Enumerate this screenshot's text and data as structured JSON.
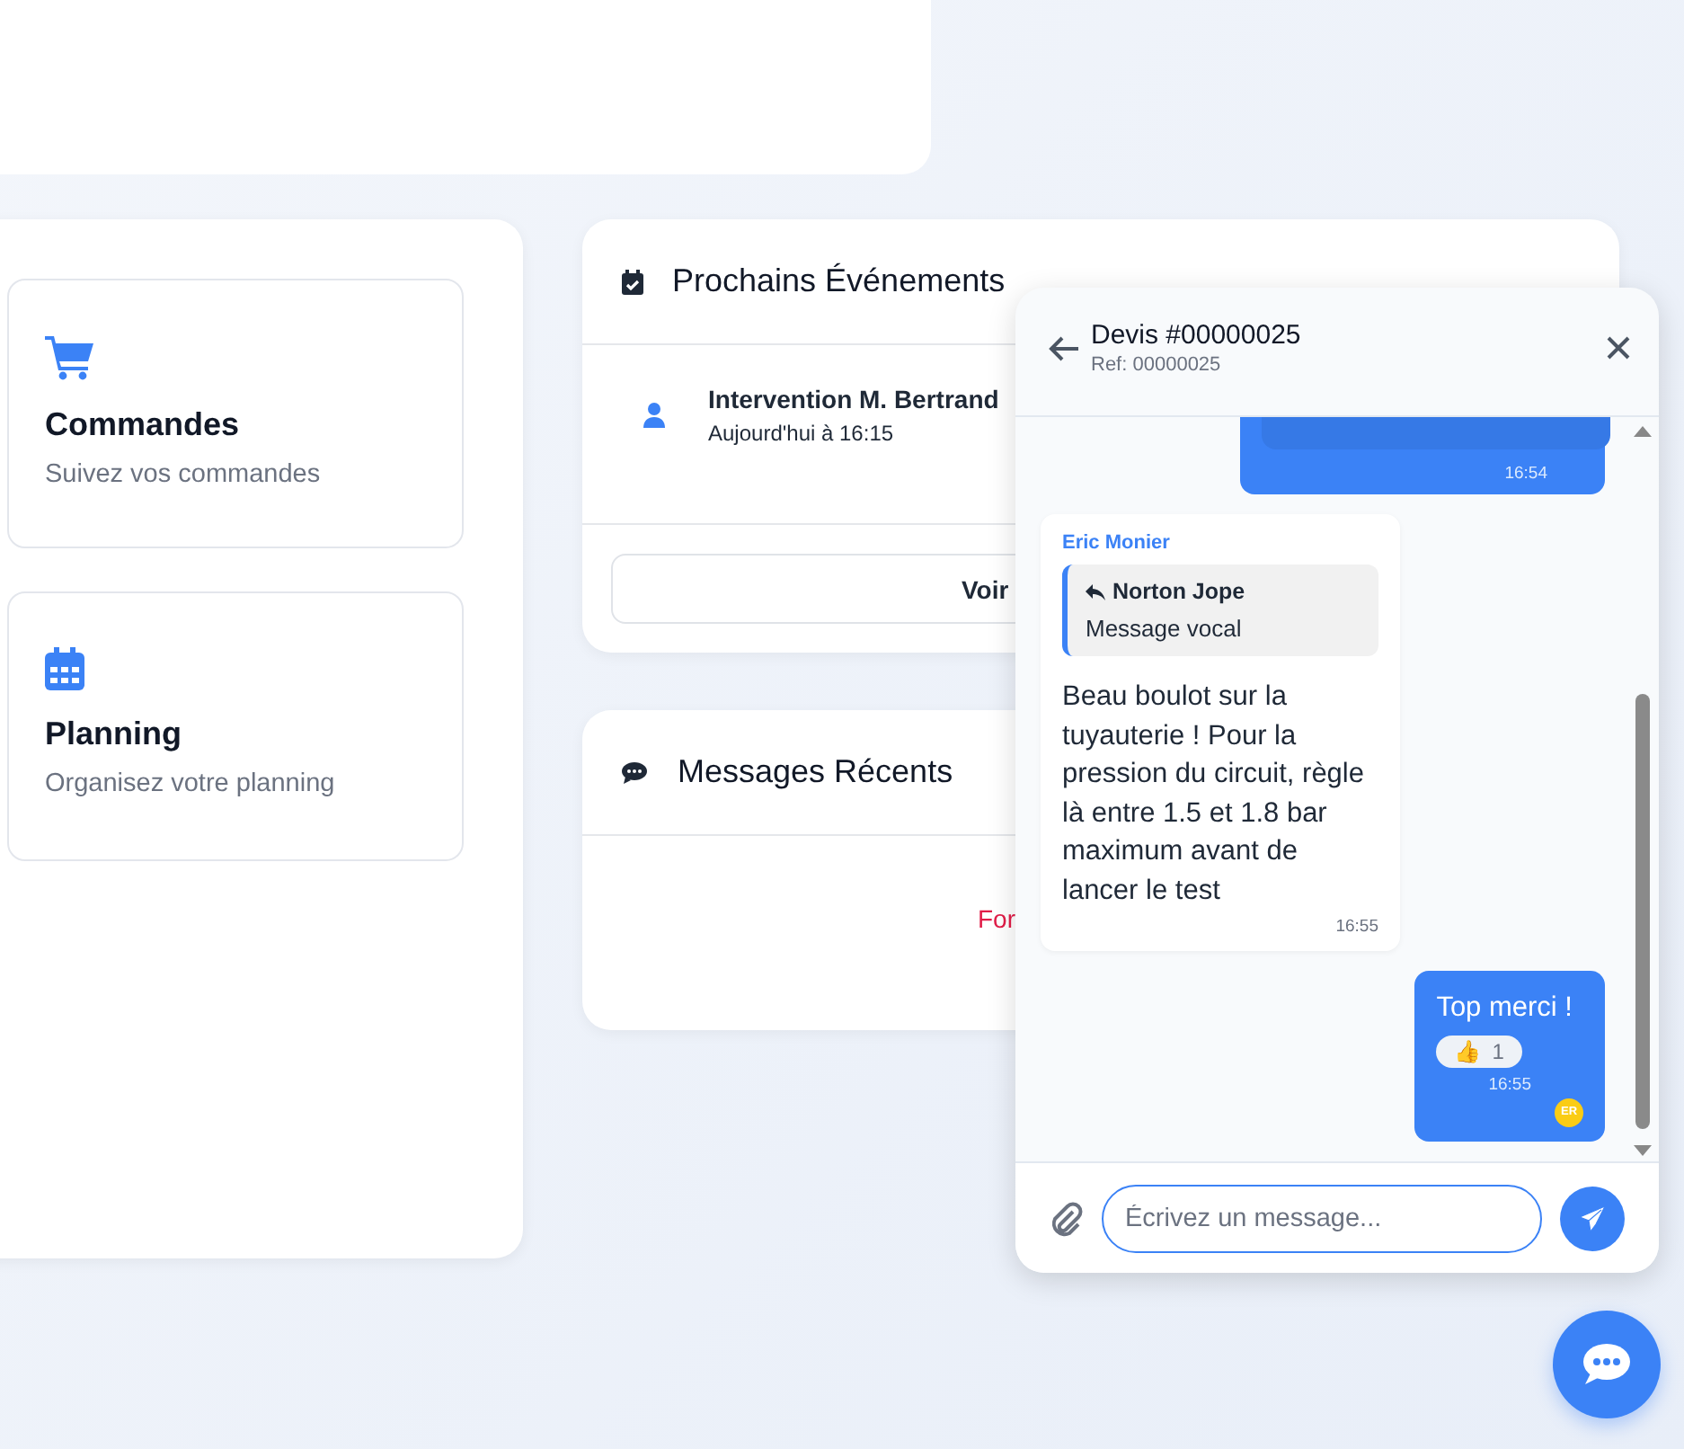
{
  "shortcuts": [
    {
      "title": "Commandes",
      "subtitle": "Suivez vos commandes"
    },
    {
      "title": "Planning",
      "subtitle": "Organisez votre planning"
    }
  ],
  "events": {
    "title": "Prochains Événements",
    "items": [
      {
        "title": "Intervention M. Bertrand",
        "time": "Aujourd'hui à 16:15"
      }
    ],
    "button": "Voir"
  },
  "recent_messages": {
    "title": "Messages Récents",
    "error": "For"
  },
  "chat": {
    "title": "Devis #00000025",
    "ref": "Ref: 00000025",
    "messages": [
      {
        "kind": "voice",
        "outgoing": true,
        "time": "16:54"
      },
      {
        "kind": "text",
        "outgoing": false,
        "sender": "Eric Monier",
        "reply_to": {
          "author": "Norton Jope",
          "text": "Message vocal"
        },
        "text": "Beau boulot sur la tuyauterie ! Pour la pression du circuit, règle là entre 1.5 et 1.8 bar maximum avant de lancer le test",
        "time": "16:55"
      },
      {
        "kind": "text",
        "outgoing": true,
        "text": "Top merci !",
        "reaction": {
          "emoji": "👍",
          "count": "1"
        },
        "time": "16:55",
        "read_by": "ER"
      }
    ],
    "input": {
      "placeholder": "Écrivez un message..."
    }
  }
}
